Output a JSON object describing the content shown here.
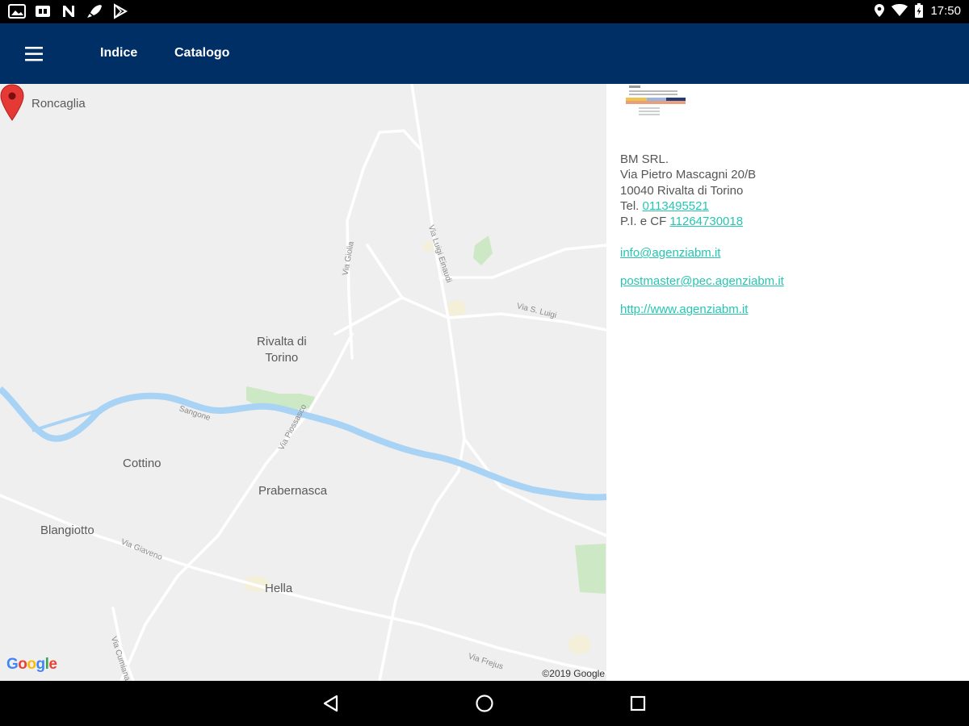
{
  "status_bar": {
    "left_icons": [
      "gallery-icon",
      "sim-card-icon",
      "n-notification-icon",
      "rocket-icon",
      "play-store-icon"
    ],
    "right_icons": [
      "location-icon",
      "wifi-icon",
      "battery-icon"
    ],
    "time": "17:50"
  },
  "app_bar": {
    "background": "#002f66",
    "menu_icon": "hamburger-menu-icon",
    "nav": [
      {
        "label": "Indice"
      },
      {
        "label": "Catalogo"
      }
    ]
  },
  "map": {
    "places": {
      "roncaglia": "Roncaglia",
      "rivalta": "Rivalta di\nTorino",
      "cottino": "Cottino",
      "prabernasca": "Prabernasca",
      "blangiotto": "Blangiotto",
      "hella": "Hella"
    },
    "roads": {
      "via_giolia": "Via Giolia",
      "via_luigi_einaudi": "Via Luigi Einaudi",
      "via_s_luigi": "Via S. Luigi",
      "sangone": "Sangone",
      "via_piossasco": "Via Piossasco",
      "via_giaveno": "Via Giaveno",
      "via_cumiana": "Via Cumiana",
      "via_frejus": "Via Frejus"
    },
    "logo": "Google",
    "copyright": "©2019 Google",
    "marker_icon": "map-pin-icon"
  },
  "info": {
    "company_logo": "company-logo",
    "name": "BM SRL.",
    "street": "Via Pietro Mascagni 20/B",
    "city": "10040 Rivalta di Torino",
    "tel_label": "Tel.",
    "tel": "0113495521",
    "vat_label": "P.I. e CF",
    "vat": "11264730018",
    "email": "info@agenziabm.it",
    "pec": "postmaster@pec.agenziabm.it",
    "website": "http://www.agenziabm.it",
    "link_color": "#26c6b0"
  },
  "system_nav": {
    "icons": [
      "back-icon",
      "home-icon",
      "recents-icon"
    ]
  }
}
